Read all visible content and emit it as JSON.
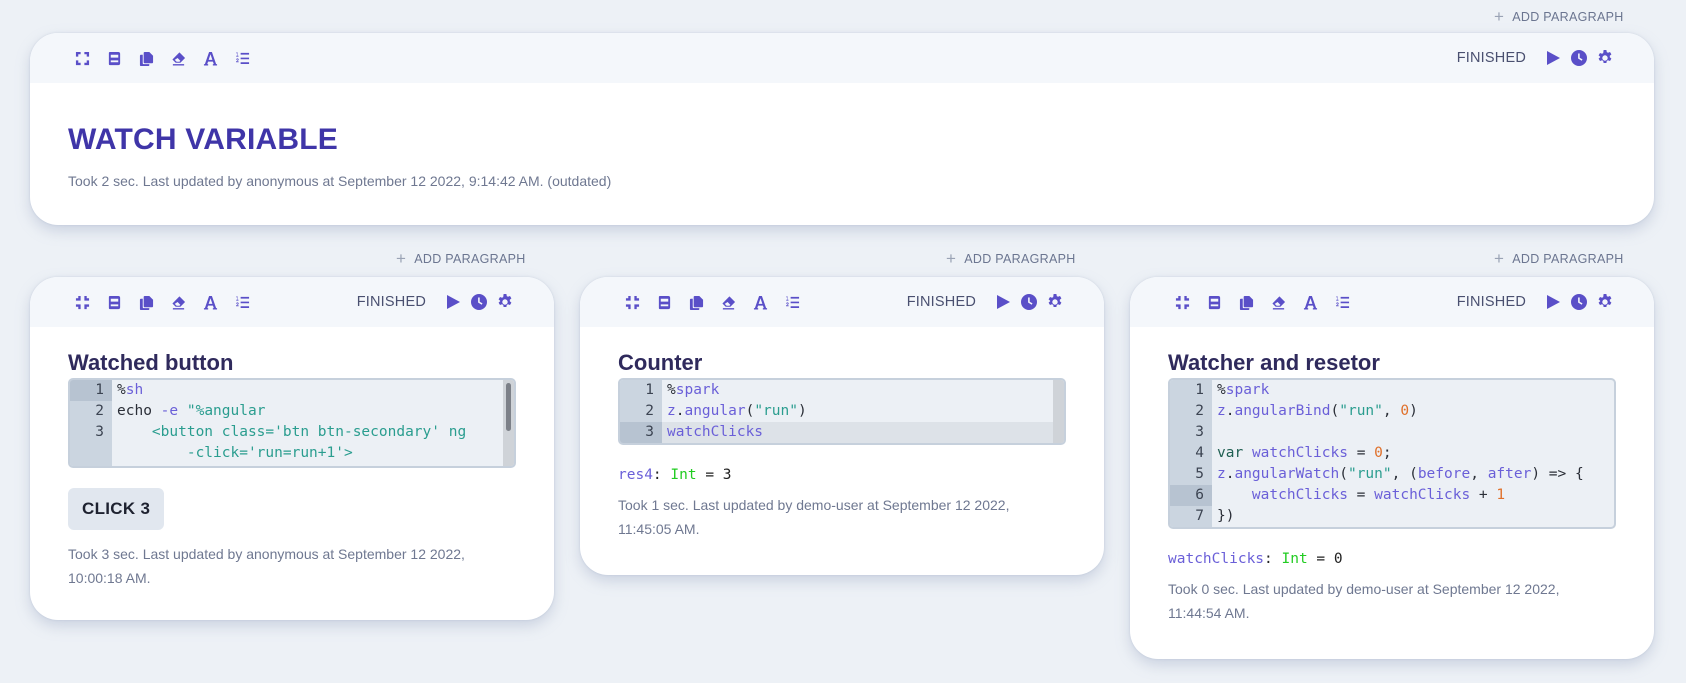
{
  "add_paragraph_label": "ADD PARAGRAPH",
  "status_label": "FINISHED",
  "icons": {
    "toolbar": [
      "expand-icon",
      "book-icon",
      "copy-icon",
      "eraser-icon",
      "font-icon",
      "line-numbers-icon"
    ],
    "toolbar_collapsed": [
      "collapse-icon",
      "book-icon",
      "copy-icon",
      "eraser-icon",
      "font-icon",
      "line-numbers-icon"
    ],
    "controls": [
      "play-icon",
      "clock-icon",
      "gear-icon"
    ]
  },
  "colors": {
    "accent": "#5a4fc8",
    "title": "#3f35a8",
    "background": "#edf1f6"
  },
  "paragraphs": [
    {
      "title": "WATCH VARIABLE",
      "status": "FINISHED",
      "meta": "Took 2 sec. Last updated by anonymous at September 12 2022, 9:14:42 AM. (outdated)"
    },
    {
      "title": "Watched button",
      "status": "FINISHED",
      "code_lines": [
        {
          "num": "1",
          "text": "%sh"
        },
        {
          "num": "2",
          "text": "echo -e \"%angular"
        },
        {
          "num": "3",
          "text": "    <button class='btn btn-secondary' ng"
        },
        {
          "num": "",
          "text": "        -click='run=run+1'>"
        }
      ],
      "button_label": "CLICK 3",
      "meta": "Took 3 sec. Last updated by anonymous at September 12 2022, 10:00:18 AM."
    },
    {
      "title": "Counter",
      "status": "FINISHED",
      "code_lines": [
        {
          "num": "1",
          "text": "%spark"
        },
        {
          "num": "2",
          "text": "z.angular(\"run\")"
        },
        {
          "num": "3",
          "text": "watchClicks"
        }
      ],
      "result": {
        "var": "res4",
        "type": "Int",
        "value": "3"
      },
      "meta": "Took 1 sec. Last updated by demo-user at September 12 2022, 11:45:05 AM."
    },
    {
      "title": "Watcher and resetor",
      "status": "FINISHED",
      "code_lines": [
        {
          "num": "1",
          "text": "%spark"
        },
        {
          "num": "2",
          "text": "z.angularBind(\"run\", 0)"
        },
        {
          "num": "3",
          "text": ""
        },
        {
          "num": "4",
          "text": "var watchClicks = 0;"
        },
        {
          "num": "5",
          "text": "z.angularWatch(\"run\", (before, after) => {"
        },
        {
          "num": "6",
          "text": "    watchClicks = watchClicks + 1"
        },
        {
          "num": "7",
          "text": "})"
        }
      ],
      "result": {
        "var": "watchClicks",
        "type": "Int",
        "value": "0"
      },
      "meta": "Took 0 sec. Last updated by demo-user at September 12 2022, 11:44:54 AM."
    }
  ]
}
